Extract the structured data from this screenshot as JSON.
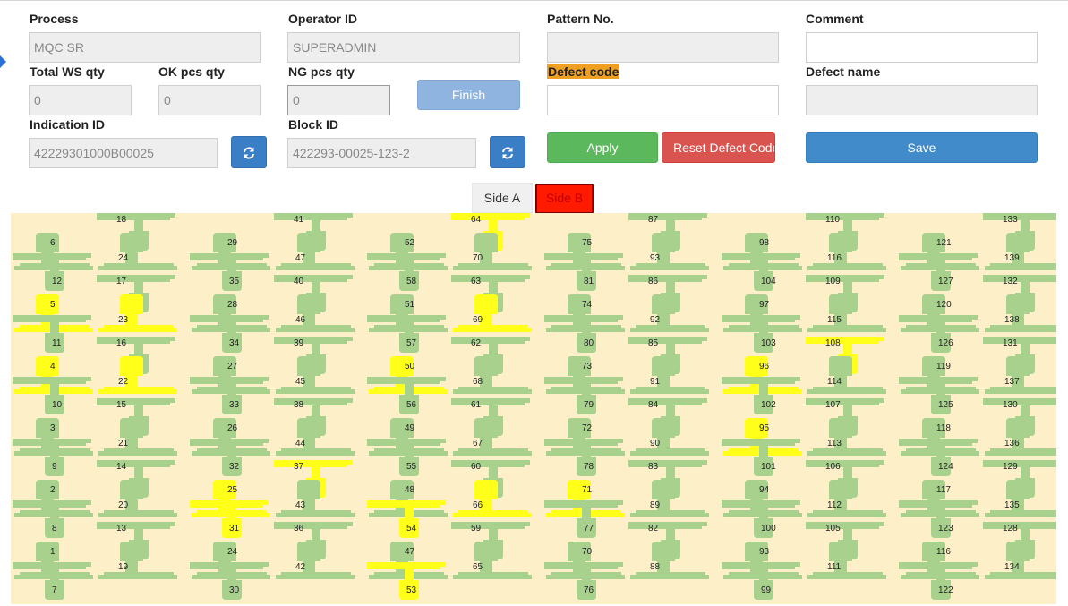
{
  "process": {
    "label": "Process",
    "value": "MQC SR"
  },
  "operator": {
    "label": "Operator ID",
    "value": "SUPERADMIN"
  },
  "pattern": {
    "label": "Pattern No.",
    "value": ""
  },
  "comment": {
    "label": "Comment",
    "value": ""
  },
  "total_ws": {
    "label": "Total WS qty",
    "value": "0"
  },
  "ok_pcs": {
    "label": "OK pcs qty",
    "value": "0"
  },
  "ng_pcs": {
    "label": "NG pcs qty",
    "value": "0"
  },
  "finish_label": "Finish",
  "defect_code": {
    "label": "Defect code",
    "value": ""
  },
  "defect_name": {
    "label": "Defect name",
    "value": ""
  },
  "indication": {
    "label": "Indication ID",
    "value": "42229301000B00025"
  },
  "block": {
    "label": "Block ID",
    "value": "422293-00025-123-2"
  },
  "apply_label": "Apply",
  "reset_label": "Reset Defect Code",
  "save_label": "Save",
  "tabs": {
    "side_a": "Side A",
    "side_b": "Side B"
  },
  "board": {
    "colors": {
      "ok": "#a8d18d",
      "ng": "#ffff1a",
      "background": "#fdf0c8"
    },
    "highlighted_pieces": [
      4,
      5,
      22,
      23,
      25,
      31,
      37,
      50,
      53,
      54,
      64,
      66,
      69,
      71,
      95,
      96,
      108
    ]
  }
}
